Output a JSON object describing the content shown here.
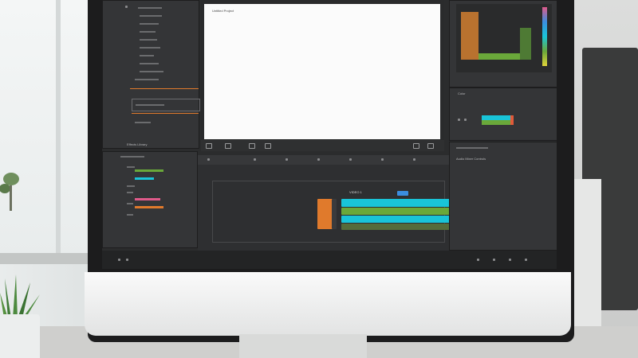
{
  "preview": {
    "title": "Untitled Project"
  },
  "left_panel": {
    "section_label": "Effects Library"
  },
  "timeline": {
    "clip_label": "VIDEO 1"
  },
  "right_mid": {
    "label": "Color"
  },
  "right_bottom": {
    "label": "Audio Mixer Controls"
  },
  "colors": {
    "accent_orange": "#e07a2c",
    "clip_cyan": "#19c4d8",
    "clip_green": "#6aa83a",
    "clip_pink": "#e05a8a",
    "clip_blue": "#3b8ee0"
  },
  "icons": [
    "play-icon",
    "pause-icon",
    "stop-icon",
    "marker-icon",
    "settings-icon",
    "folder-icon"
  ]
}
